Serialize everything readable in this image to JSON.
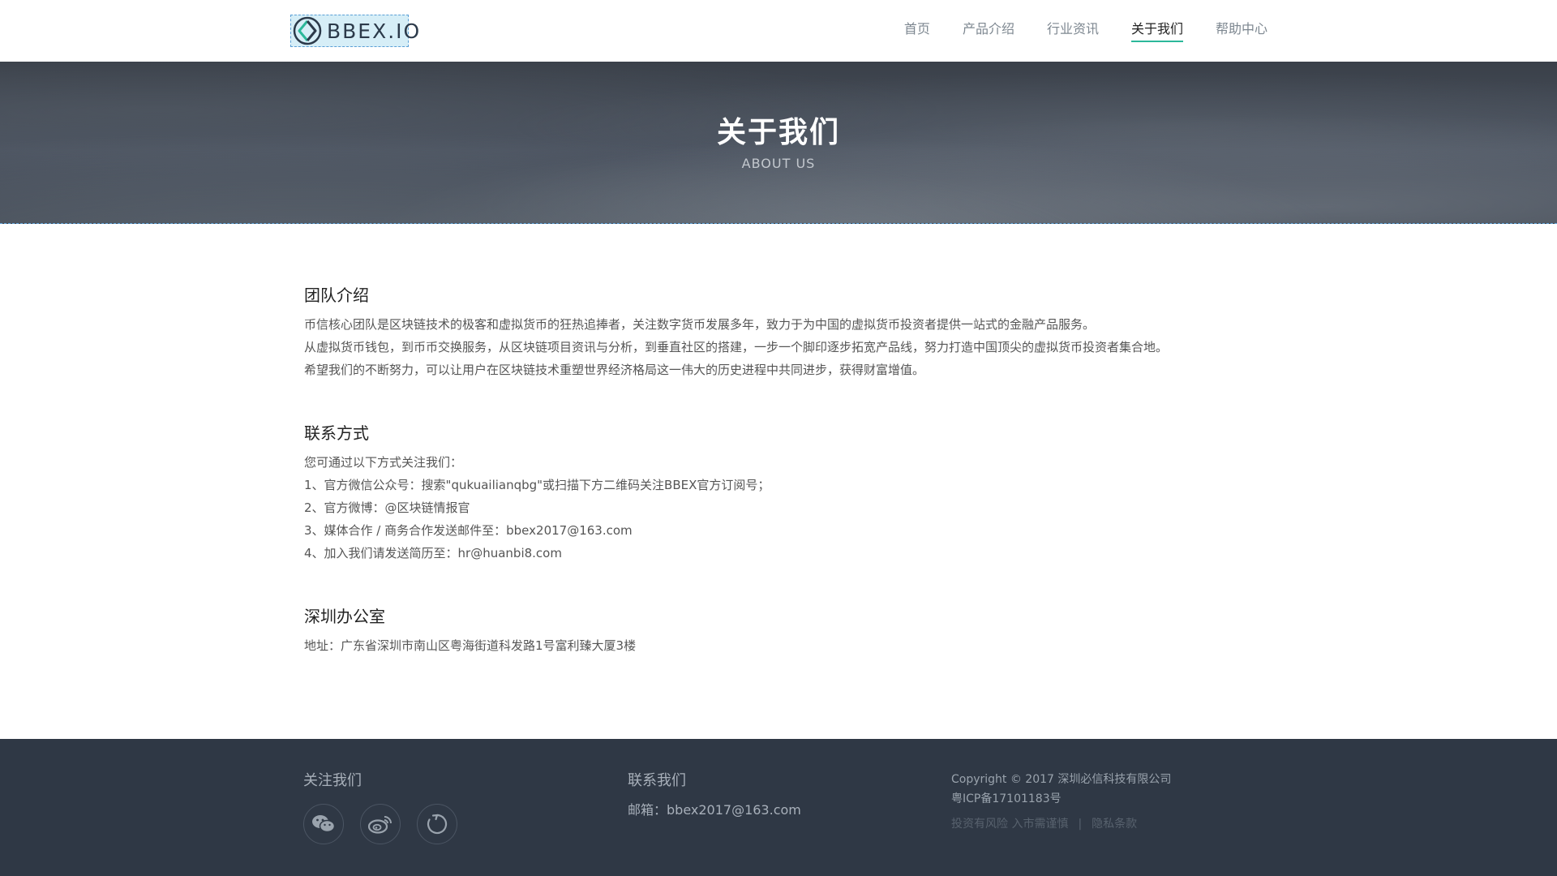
{
  "header": {
    "logo_text": "BBEX.IO",
    "nav": [
      {
        "label": "首页",
        "active": false
      },
      {
        "label": "产品介绍",
        "active": false
      },
      {
        "label": "行业资讯",
        "active": false
      },
      {
        "label": "关于我们",
        "active": true
      },
      {
        "label": "帮助中心",
        "active": false
      }
    ],
    "accent_color": "#2bb89a"
  },
  "banner": {
    "title": "关于我们",
    "subtitle": "ABOUT US"
  },
  "sections": {
    "team": {
      "title": "团队介绍",
      "lines": [
        "币信核心团队是区块链技术的极客和虚拟货币的狂热追捧者，关注数字货币发展多年，致力于为中国的虚拟货币投资者提供一站式的金融产品服务。",
        "从虚拟货币钱包，到币币交换服务，从区块链项目资讯与分析，到垂直社区的搭建，一步一个脚印逐步拓宽产品线，努力打造中国顶尖的虚拟货币投资者集合地。",
        "希望我们的不断努力，可以让用户在区块链技术重塑世界经济格局这一伟大的历史进程中共同进步，获得财富增值。"
      ]
    },
    "contact": {
      "title": "联系方式",
      "lines": [
        "您可通过以下方式关注我们：",
        "1、官方微信公众号：搜索\"qukuailianqbg\"或扫描下方二维码关注BBEX官方订阅号；",
        "2、官方微博：@区块链情报官",
        "3、媒体合作 / 商务合作发送邮件至：bbex2017@163.com",
        "4、加入我们请发送简历至：hr@huanbi8.com"
      ]
    },
    "office": {
      "title": "深圳办公室",
      "lines": [
        "地址：广东省深圳市南山区粤海街道科发路1号富利臻大厦3楼"
      ]
    }
  },
  "footer": {
    "follow_title": "关注我们",
    "icons": [
      "wechat-icon",
      "weibo-icon",
      "refresh-icon"
    ],
    "contact_title": "联系我们",
    "email": "邮箱：bbex2017@163.com",
    "copyright": "Copyright © 2017 深圳必信科技有限公司",
    "icp": "粤ICP备17101183号",
    "risk_link": "投资有风险 入市需谨慎",
    "separator": "|",
    "privacy_link": "隐私条款",
    "bg_color": "#2f3845"
  }
}
